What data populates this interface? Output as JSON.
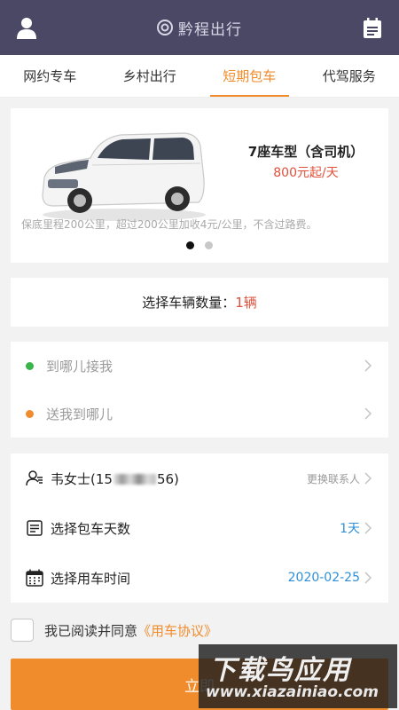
{
  "header": {
    "brand": "黔程出行",
    "left_icon": "user-icon",
    "right_icon": "calendar-icon",
    "bg": "#4b4866"
  },
  "tabs": [
    {
      "label": "网约专车",
      "active": false
    },
    {
      "label": "乡村出行",
      "active": false
    },
    {
      "label": "短期包车",
      "active": true
    },
    {
      "label": "代驾服务",
      "active": false
    }
  ],
  "car": {
    "title": "7座车型（含司机）",
    "price": "800元起/天",
    "desc": "保底里程200公里，超过200公里加收4元/公里，不含过路费。",
    "carousel_pages": 2,
    "carousel_current": 1
  },
  "quantity": {
    "label": "选择车辆数量：",
    "value": "1辆"
  },
  "route": {
    "pickup": "到哪儿接我",
    "dropoff": "送我到哪儿"
  },
  "info": {
    "contact_prefix": "韦女士(15",
    "contact_suffix": "56)",
    "contact_action": "更换联系人",
    "days_label": "选择包车天数",
    "days_value": "1天",
    "time_label": "选择用车时间",
    "time_value": "2020-02-25"
  },
  "agreement": {
    "text": "我已阅读并同意",
    "link": "《用车协议》",
    "checked": false
  },
  "submit": {
    "label": "立即"
  },
  "watermark": {
    "title": "下载鸟应用",
    "url": "www.xiazainiao.com"
  },
  "colors": {
    "accent": "#f08c2c",
    "price": "#e0503a",
    "blue_value": "#2e8fd6",
    "pickup_dot": "#3ab54a",
    "dropoff_dot": "#f08c2c"
  }
}
